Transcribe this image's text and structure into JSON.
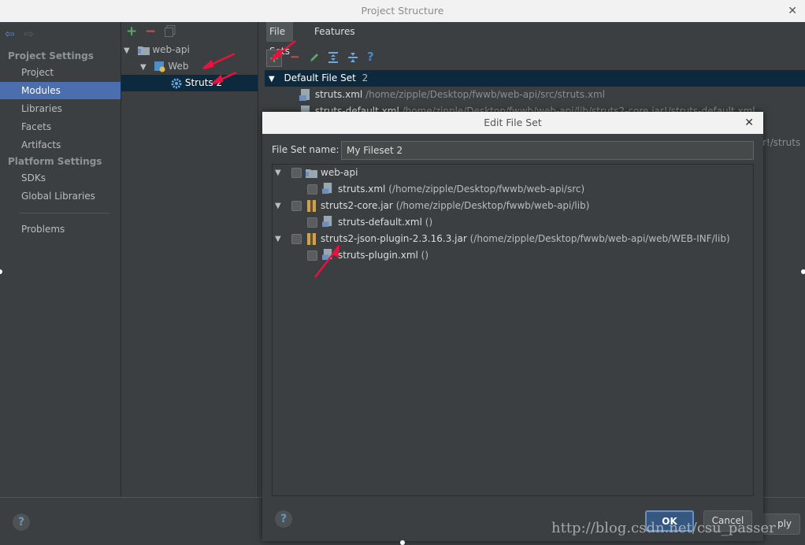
{
  "window": {
    "title": "Project Structure"
  },
  "nav": {
    "project_settings": "Project Settings",
    "platform_settings": "Platform Settings",
    "items_project": [
      "Project",
      "Modules",
      "Libraries",
      "Facets",
      "Artifacts"
    ],
    "items_platform": [
      "SDKs",
      "Global Libraries"
    ],
    "problems": "Problems"
  },
  "module_tree": {
    "root": "web-api",
    "child": "Web",
    "grandchild": "Struts 2"
  },
  "tabs": [
    "File Sets",
    "Features"
  ],
  "file_sets": {
    "group_label": "Default File Set",
    "group_count": "2",
    "rows": [
      {
        "name": "struts.xml",
        "path": "/home/zipple/Desktop/fwwb/web-api/src/struts.xml"
      },
      {
        "name": "struts-default.xml",
        "path": "/home/zipple/Desktop/fwwb/web-api/lib/struts2-core.jar!/struts-default.xml"
      }
    ],
    "partial_right": "r!/struts"
  },
  "dialog": {
    "title": "Edit File Set",
    "name_label": "File Set name:",
    "name_value": "My Fileset 2",
    "tree": [
      {
        "label": "web-api",
        "path": ""
      },
      {
        "label": "struts.xml",
        "path": "(/home/zipple/Desktop/fwwb/web-api/src)"
      },
      {
        "label": "struts2-core.jar",
        "path": "(/home/zipple/Desktop/fwwb/web-api/lib)"
      },
      {
        "label": "struts-default.xml",
        "path": "()"
      },
      {
        "label": "struts2-json-plugin-2.3.16.3.jar",
        "path": "(/home/zipple/Desktop/fwwb/web-api/web/WEB-INF/lib)"
      },
      {
        "label": "struts-plugin.xml",
        "path": "()"
      }
    ],
    "ok": "OK",
    "cancel": "Cancel"
  },
  "bottom": {
    "apply_partial": "ply"
  },
  "watermark": "http://blog.csdn.net/csu_passer",
  "colors": {
    "accent": "#4b6eaf",
    "selection": "#0d293e",
    "add": "#59a869",
    "remove": "#c75450",
    "annotation": "#e8123f"
  }
}
